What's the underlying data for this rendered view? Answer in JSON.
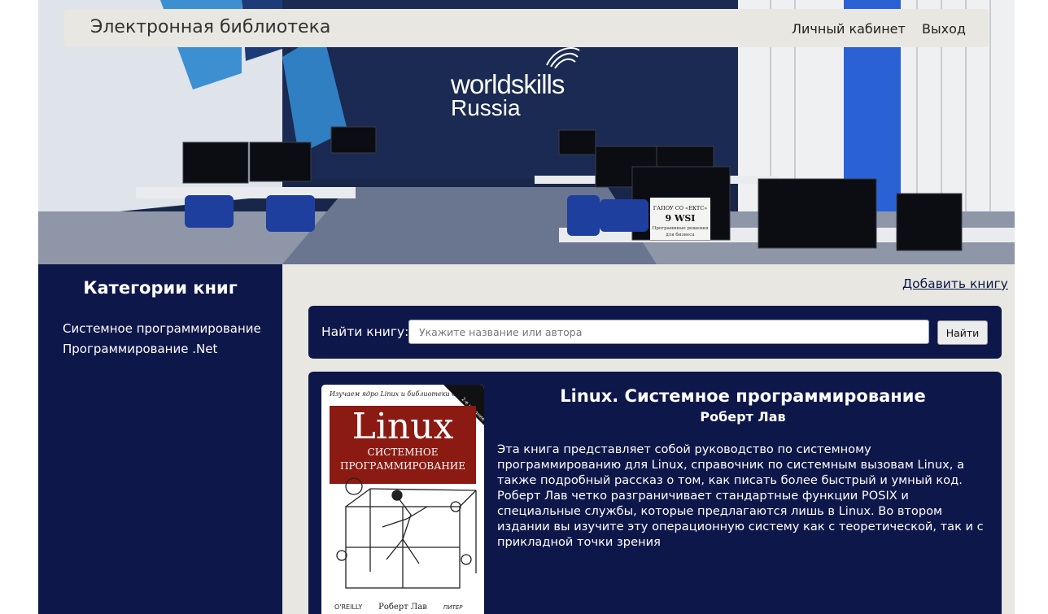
{
  "header": {
    "brand": "Электронная библиотека",
    "nav": {
      "account": "Личный кабинет",
      "logout": "Выход"
    }
  },
  "hero": {
    "sign_line1": "worldskills",
    "sign_line2": "Russia",
    "desk_sign_line1": "ГАПОУ СО «ЕКТС»",
    "desk_sign_line2": "9 WSI",
    "desk_sign_line3": "Программные решения",
    "desk_sign_line4": "для бизнеса"
  },
  "sidebar": {
    "title": "Категории книг",
    "categories": [
      "Системное программирование",
      "Программирование .Net"
    ]
  },
  "main": {
    "add_book": "Добавить книгу",
    "search": {
      "label": "Найти книгу:",
      "placeholder": "Укажите название или автора",
      "value": "",
      "button": "Найти"
    },
    "books": [
      {
        "title": "Linux. Системное программирование",
        "author": "Роберт Лав",
        "description": "Эта книга представляет собой руководство по системному программированию для Linux, справочник по системным вызовам Linux, а также подробный рассказ о том, как писать более быстрый и умный код. Роберт Лав четко разграничивает стандартные функции POSIX и специальные службы, которые предлагаются лишь в Linux. Во втором издании вы изучите эту операционную систему как с теоретической, так и с прикладной точки зрения",
        "cover": {
          "top_text": "Изучаем ядро Linux и библиотеки C",
          "edition": "2-е издание",
          "title_big": "Linux",
          "subtitle_1": "СИСТЕМНОЕ",
          "subtitle_2": "ПРОГРАММИРОВАНИЕ",
          "publisher_left": "O'REILLY",
          "author": "Роберт Лав",
          "publisher_right": "ПИТЕР"
        }
      }
    ]
  },
  "colors": {
    "navy": "#0e174a",
    "background": "#e8e7e1",
    "cover_red": "#8b1a12"
  }
}
